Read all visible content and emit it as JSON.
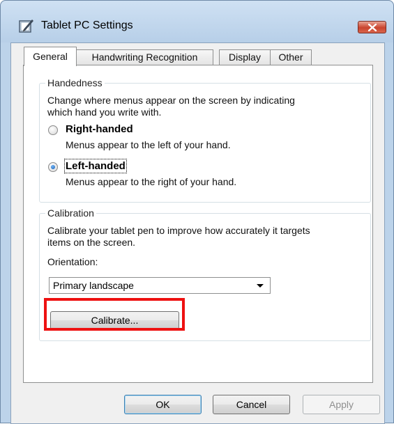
{
  "window": {
    "title": "Tablet PC Settings",
    "app_icon": "pen-tablet-icon",
    "close_icon": "close-icon"
  },
  "tabs": [
    {
      "label": "General",
      "selected": true
    },
    {
      "label": "Handwriting Recognition",
      "selected": false
    },
    {
      "label": "Display",
      "selected": false
    },
    {
      "label": "Other",
      "selected": false
    }
  ],
  "handedness": {
    "group_title": "Handedness",
    "description_line1": "Change where menus appear on the screen by indicating",
    "description_line2": "which hand you write with.",
    "right": {
      "label": "Right-handed",
      "description": "Menus appear to the left of your hand.",
      "checked": false
    },
    "left": {
      "label": "Left-handed",
      "description": "Menus appear to the right of your hand.",
      "checked": true
    }
  },
  "calibration": {
    "group_title": "Calibration",
    "description_line1": "Calibrate your tablet pen to improve how accurately it targets",
    "description_line2": "items on the screen.",
    "orientation_label": "Orientation:",
    "orientation_value": "Primary landscape",
    "calibrate_button": "Calibrate..."
  },
  "footer": {
    "ok": "OK",
    "cancel": "Cancel",
    "apply": "Apply"
  },
  "colors": {
    "highlight": "#ee1111",
    "title_bar": "#bcd3ea",
    "close_button": "#c9442e"
  }
}
